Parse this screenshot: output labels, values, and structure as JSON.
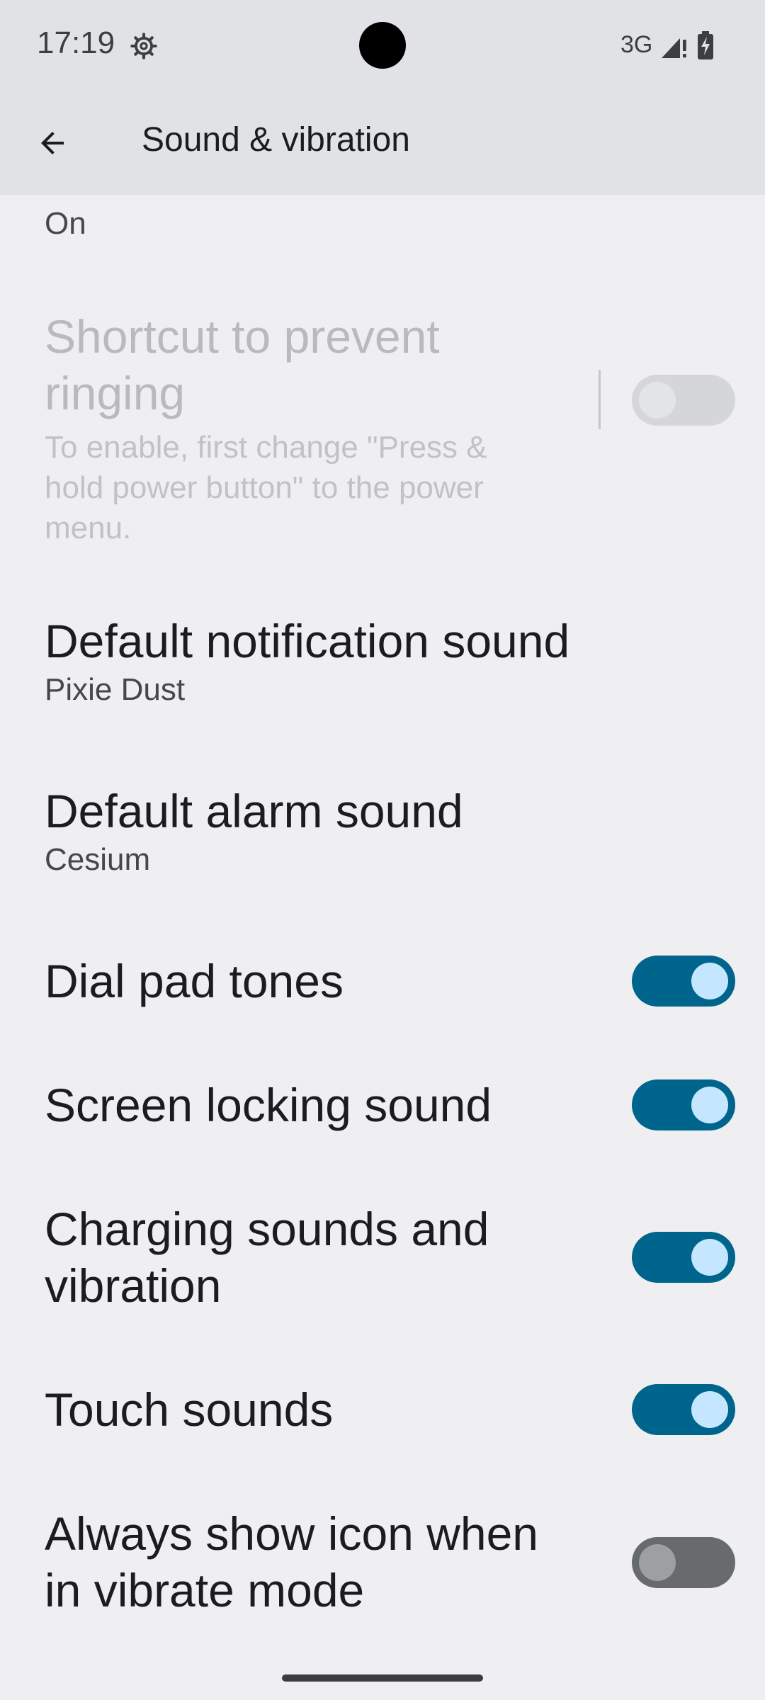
{
  "status_bar": {
    "time": "17:19",
    "network": "3G",
    "icons": [
      "settings-gear-icon",
      "signal-icon",
      "battery-charging-icon"
    ]
  },
  "app_bar": {
    "title": "Sound & vibration",
    "back_icon": "arrow-back-icon"
  },
  "items": [
    {
      "summary": "On"
    },
    {
      "title": "Shortcut to prevent ringing",
      "summary": "To enable, first change \"Press & hold power button\" to the power menu.",
      "toggle": "disabled"
    },
    {
      "title": "Default notification sound",
      "summary": "Pixie Dust"
    },
    {
      "title": "Default alarm sound",
      "summary": "Cesium"
    },
    {
      "title": "Dial pad tones",
      "toggle": "on"
    },
    {
      "title": "Screen locking sound",
      "toggle": "on"
    },
    {
      "title": "Charging sounds and vibration",
      "toggle": "on"
    },
    {
      "title": "Touch sounds",
      "toggle": "on"
    },
    {
      "title": "Always show icon when in vibrate mode",
      "toggle": "off"
    }
  ],
  "colors": {
    "toggle_on_track": "#00658c",
    "toggle_on_thumb": "#c4e7ff",
    "toggle_off_track": "#676b6e",
    "background": "#efeff1",
    "app_bar": "#e1e2e5"
  }
}
